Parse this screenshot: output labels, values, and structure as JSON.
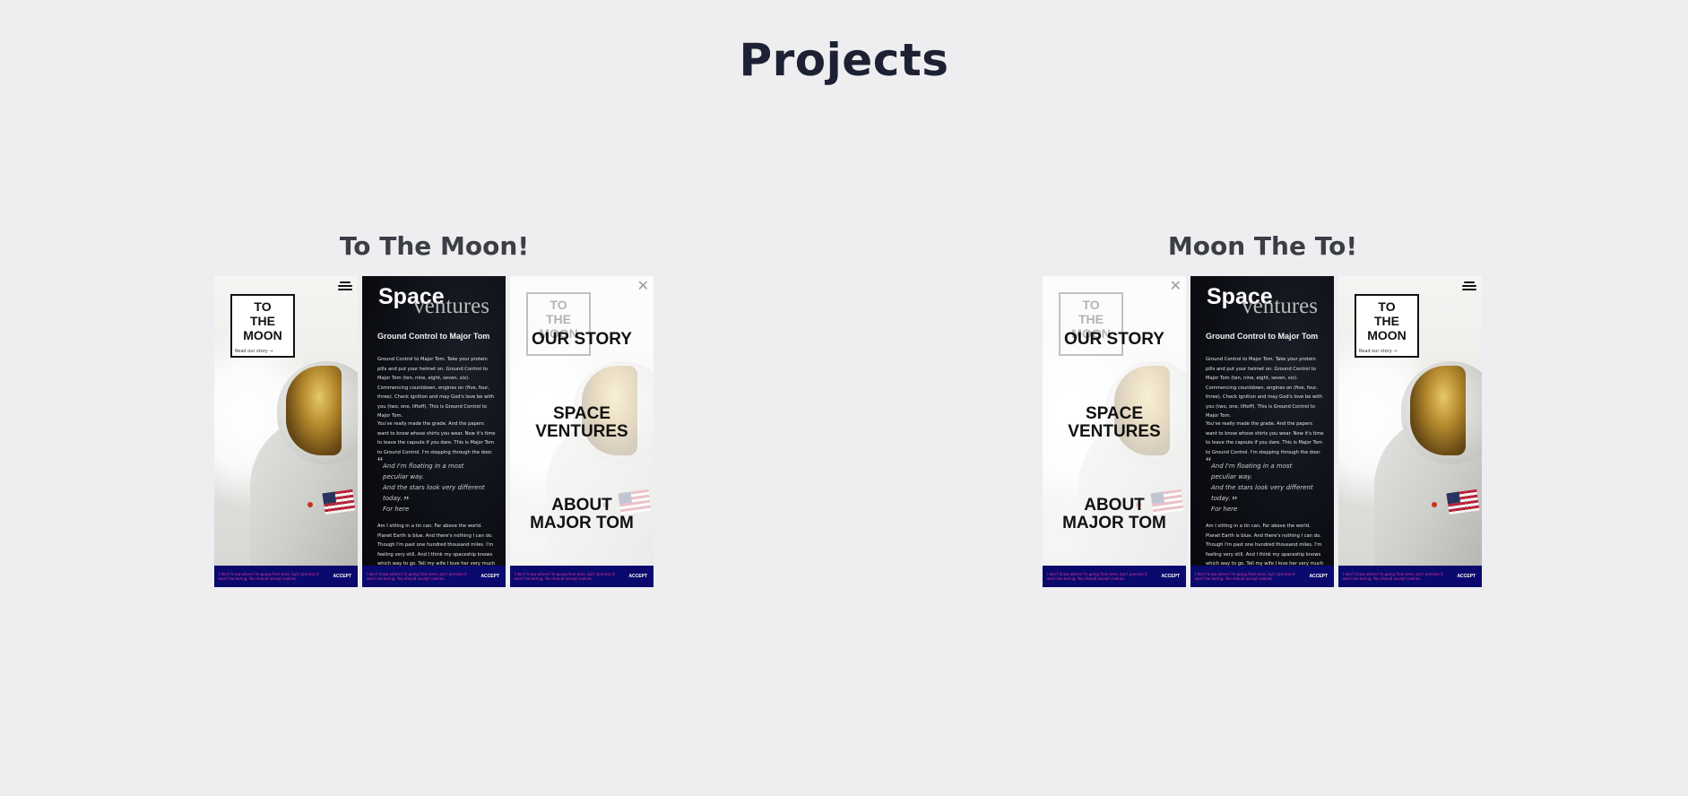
{
  "page": {
    "title": "Projects"
  },
  "common": {
    "logo_text": "TO\nTHE\nMOON",
    "story_link": "Read our story  →",
    "brand_line1": "Space",
    "brand_line2": "ventures",
    "article_heading": "Ground Control to Major Tom",
    "article_para1": "Ground Control to Major Tom. Take your protein pills and put your helmet on. Ground Control to Major Tom (ten, nine, eight, seven, six). Commencing countdown, engines on (five, four, three). Check ignition and may God's love be with you (two, one, liftoff). This is Ground Control to Major Tom.",
    "article_para2": "You've really made the grade. And the papers want to know whose shirts you wear. Now it's time to leave the capsule if you dare. This is Major Tom to Ground Control. I'm stepping through the door.",
    "article_quote": "And I'm floating in a most peculiar way.\nAnd the stars look very different today.\nFor here",
    "article_para3": "Am I sitting in a tin can. Far above the world. Planet Earth is blue. And there's nothing I can do. Though I'm past one hundred thousand miles. I'm feeling very still. And I think my spaceship knows which way to go. Tell my wife I love her very much",
    "menu_items": [
      "OUR STORY",
      "SPACE\nVENTURES",
      "ABOUT\nMAJOR TOM"
    ],
    "cookie_text": "I don't know where I'm going from here, but I promise it won't be boring. You should accept cookies.",
    "cookie_button": "ACCEPT",
    "close_glyph": "✕",
    "open_quote": "“",
    "close_quote": "”"
  },
  "projects": [
    {
      "title": "To The Moon!",
      "order": [
        "home",
        "article",
        "menu"
      ]
    },
    {
      "title": "Moon The To!",
      "order": [
        "menu",
        "article",
        "home"
      ]
    }
  ],
  "colors": {
    "background": "#eeeef0",
    "cookie_bar": "#0a0a6e",
    "cookie_text": "#e0359b",
    "article_bg": "#0c0e14"
  },
  "icons": [
    "hamburger-menu-icon",
    "close-icon",
    "arrow-right-icon"
  ]
}
